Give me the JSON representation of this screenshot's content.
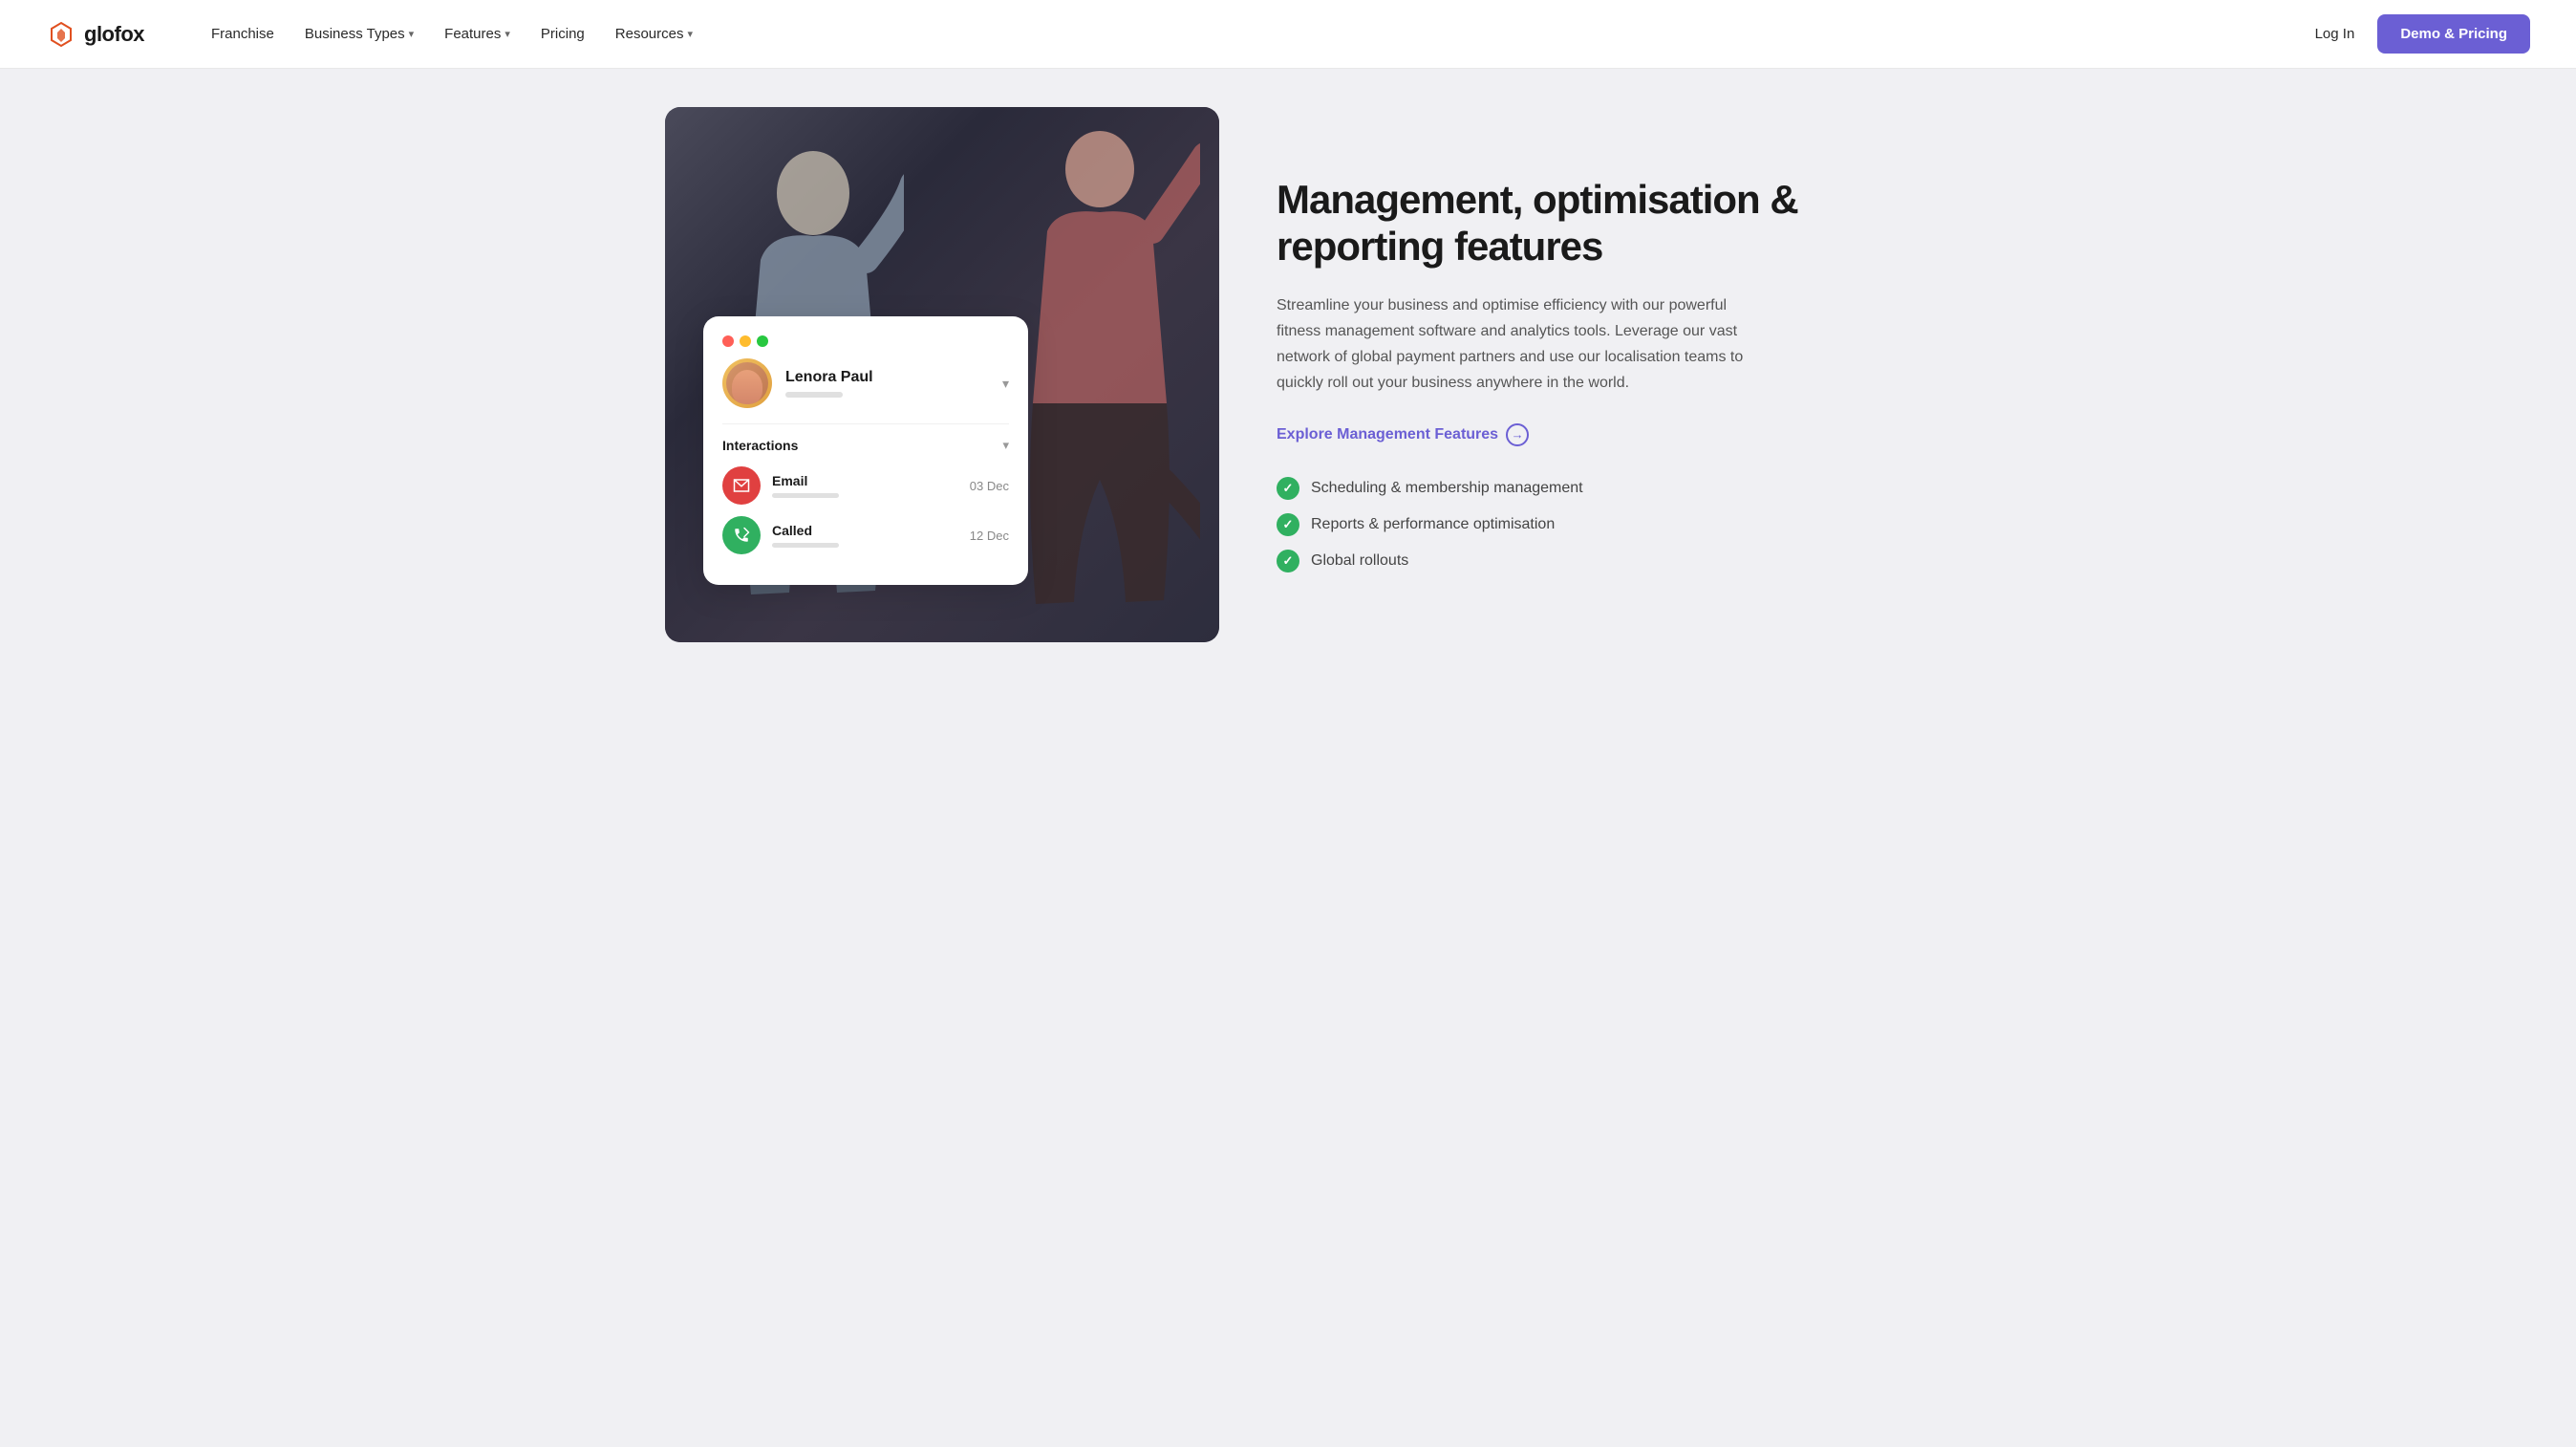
{
  "nav": {
    "logo_text": "glofox",
    "links": [
      {
        "label": "Franchise",
        "has_dropdown": false
      },
      {
        "label": "Business Types",
        "has_dropdown": true
      },
      {
        "label": "Features",
        "has_dropdown": true
      },
      {
        "label": "Pricing",
        "has_dropdown": false
      },
      {
        "label": "Resources",
        "has_dropdown": true
      }
    ],
    "login_label": "Log In",
    "cta_label": "Demo & Pricing"
  },
  "card": {
    "user_name": "Lenora Paul",
    "section_title": "Interactions",
    "interactions": [
      {
        "label": "Email",
        "date": "03 Dec",
        "type": "email"
      },
      {
        "label": "Called",
        "date": "12 Dec",
        "type": "called"
      }
    ]
  },
  "hero": {
    "heading": "Management, optimisation & reporting features",
    "description": "Streamline your business and optimise efficiency with our powerful fitness management software and analytics tools. Leverage our vast network of global payment partners and use our localisation teams to quickly roll out your business anywhere in the world.",
    "explore_link": "Explore Management Features",
    "features": [
      "Scheduling & membership management",
      "Reports & performance optimisation",
      "Global rollouts"
    ]
  }
}
